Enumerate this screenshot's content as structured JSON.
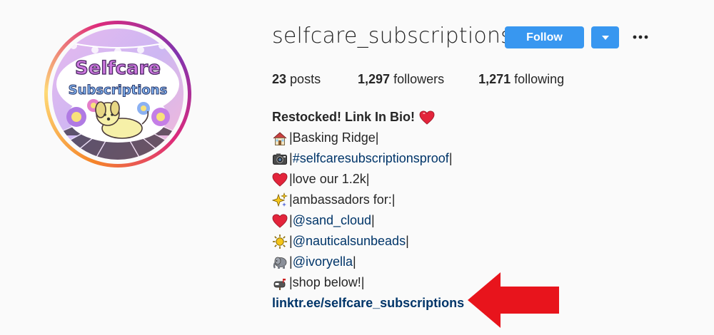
{
  "profile": {
    "username": "selfcare_subscriptions",
    "follow_label": "Follow",
    "more_label": "•••"
  },
  "stats": {
    "posts_count": "23",
    "posts_label": "posts",
    "followers_count": "1,297",
    "followers_label": "followers",
    "following_count": "1,271",
    "following_label": "following"
  },
  "bio": {
    "name": "Restocked! Link In Bio!",
    "lines": [
      {
        "icon": "house-icon",
        "pre": "|Basking Ridge|",
        "tag": "",
        "post": ""
      },
      {
        "icon": "camera-icon",
        "pre": "| ",
        "tag": "#selfcaresubscriptionsproof",
        "post": "|"
      },
      {
        "icon": "heart-icon",
        "pre": "|love our 1.2k|",
        "tag": "",
        "post": ""
      },
      {
        "icon": "sparkles-icon",
        "pre": "|ambassadors for:|",
        "tag": "",
        "post": ""
      },
      {
        "icon": "heart-icon",
        "pre": "|",
        "tag": "@sand_cloud",
        "post": "|"
      },
      {
        "icon": "sun-icon",
        "pre": "|",
        "tag": "@nauticalsunbeads",
        "post": "|"
      },
      {
        "icon": "elephant-icon",
        "pre": "|",
        "tag": "@ivoryella",
        "post": "|"
      },
      {
        "icon": "mailbox-icon",
        "pre": "|shop below!|",
        "tag": "",
        "post": ""
      }
    ],
    "link": "linktr.ee/selfcare_subscriptions"
  },
  "avatar": {
    "logo_text_line1": "Selfcare",
    "logo_text_line2": "Subscriptions"
  },
  "colors": {
    "follow_blue": "#3897f0",
    "hashtag_blue": "#003569",
    "arrow_red": "#e8141c"
  }
}
